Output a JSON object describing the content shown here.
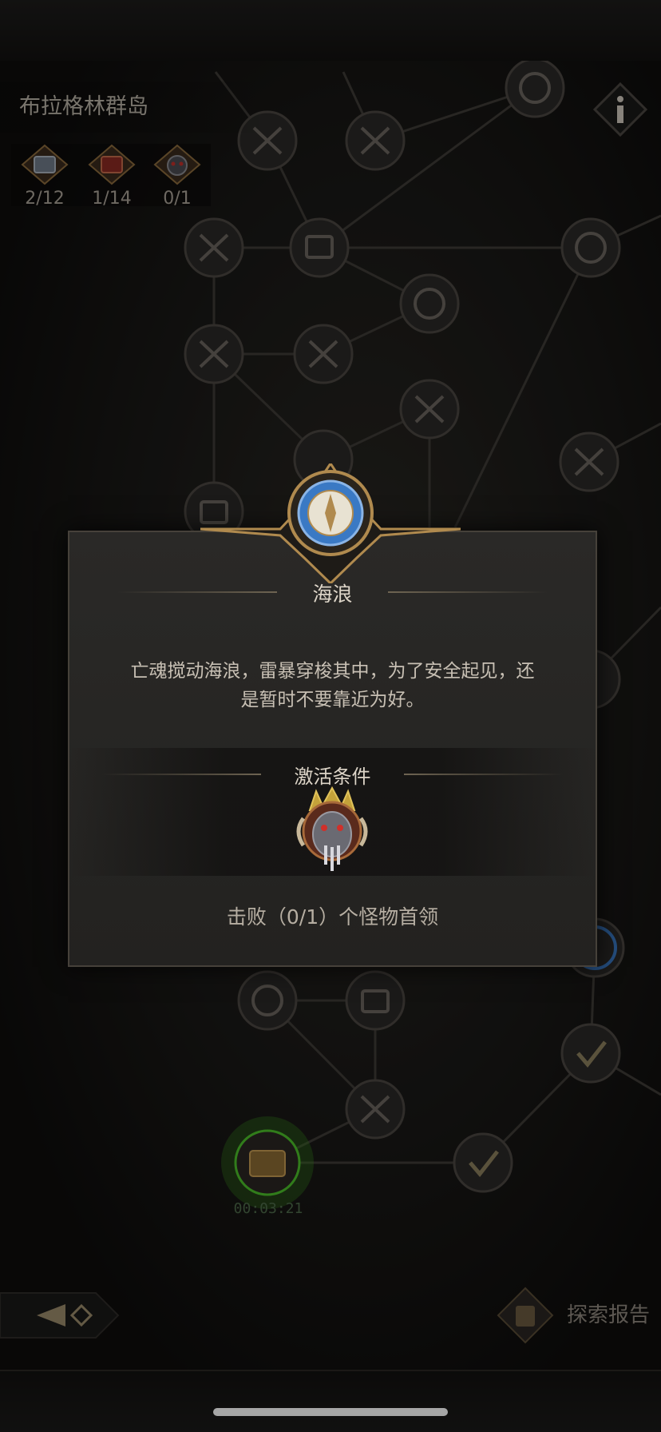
{
  "region": {
    "title": "布拉格林群岛"
  },
  "counters": [
    {
      "icon": "silver-chest-icon",
      "value": "2/12"
    },
    {
      "icon": "red-chest-icon",
      "value": "1/14"
    },
    {
      "icon": "demon-boss-icon",
      "value": "0/1"
    }
  ],
  "timer": "00:03:21",
  "report_label": "探索报告",
  "modal": {
    "title": "海浪",
    "description": "亡魂搅动海浪，雷暴穿梭其中，为了安全起见，还是暂时不要靠近为好。",
    "condition_title": "激活条件",
    "condition_text": "击败（0/1）个怪物首领"
  },
  "colors": {
    "gold": "#b08a4e",
    "node_fill": "#2d2c2a",
    "active_green": "#4cbf2a",
    "compass_blue": "#3a79c4"
  }
}
